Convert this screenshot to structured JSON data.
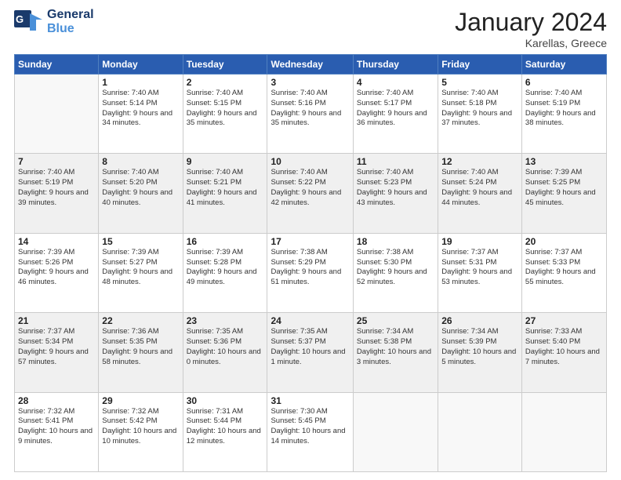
{
  "header": {
    "logo_line1": "General",
    "logo_line2": "Blue",
    "month_title": "January 2024",
    "location": "Karellas, Greece"
  },
  "weekdays": [
    "Sunday",
    "Monday",
    "Tuesday",
    "Wednesday",
    "Thursday",
    "Friday",
    "Saturday"
  ],
  "weeks": [
    [
      {
        "day": "",
        "empty": true
      },
      {
        "day": "1",
        "sunrise": "Sunrise: 7:40 AM",
        "sunset": "Sunset: 5:14 PM",
        "daylight": "Daylight: 9 hours and 34 minutes."
      },
      {
        "day": "2",
        "sunrise": "Sunrise: 7:40 AM",
        "sunset": "Sunset: 5:15 PM",
        "daylight": "Daylight: 9 hours and 35 minutes."
      },
      {
        "day": "3",
        "sunrise": "Sunrise: 7:40 AM",
        "sunset": "Sunset: 5:16 PM",
        "daylight": "Daylight: 9 hours and 35 minutes."
      },
      {
        "day": "4",
        "sunrise": "Sunrise: 7:40 AM",
        "sunset": "Sunset: 5:17 PM",
        "daylight": "Daylight: 9 hours and 36 minutes."
      },
      {
        "day": "5",
        "sunrise": "Sunrise: 7:40 AM",
        "sunset": "Sunset: 5:18 PM",
        "daylight": "Daylight: 9 hours and 37 minutes."
      },
      {
        "day": "6",
        "sunrise": "Sunrise: 7:40 AM",
        "sunset": "Sunset: 5:19 PM",
        "daylight": "Daylight: 9 hours and 38 minutes."
      }
    ],
    [
      {
        "day": "7",
        "sunrise": "Sunrise: 7:40 AM",
        "sunset": "Sunset: 5:19 PM",
        "daylight": "Daylight: 9 hours and 39 minutes."
      },
      {
        "day": "8",
        "sunrise": "Sunrise: 7:40 AM",
        "sunset": "Sunset: 5:20 PM",
        "daylight": "Daylight: 9 hours and 40 minutes."
      },
      {
        "day": "9",
        "sunrise": "Sunrise: 7:40 AM",
        "sunset": "Sunset: 5:21 PM",
        "daylight": "Daylight: 9 hours and 41 minutes."
      },
      {
        "day": "10",
        "sunrise": "Sunrise: 7:40 AM",
        "sunset": "Sunset: 5:22 PM",
        "daylight": "Daylight: 9 hours and 42 minutes."
      },
      {
        "day": "11",
        "sunrise": "Sunrise: 7:40 AM",
        "sunset": "Sunset: 5:23 PM",
        "daylight": "Daylight: 9 hours and 43 minutes."
      },
      {
        "day": "12",
        "sunrise": "Sunrise: 7:40 AM",
        "sunset": "Sunset: 5:24 PM",
        "daylight": "Daylight: 9 hours and 44 minutes."
      },
      {
        "day": "13",
        "sunrise": "Sunrise: 7:39 AM",
        "sunset": "Sunset: 5:25 PM",
        "daylight": "Daylight: 9 hours and 45 minutes."
      }
    ],
    [
      {
        "day": "14",
        "sunrise": "Sunrise: 7:39 AM",
        "sunset": "Sunset: 5:26 PM",
        "daylight": "Daylight: 9 hours and 46 minutes."
      },
      {
        "day": "15",
        "sunrise": "Sunrise: 7:39 AM",
        "sunset": "Sunset: 5:27 PM",
        "daylight": "Daylight: 9 hours and 48 minutes."
      },
      {
        "day": "16",
        "sunrise": "Sunrise: 7:39 AM",
        "sunset": "Sunset: 5:28 PM",
        "daylight": "Daylight: 9 hours and 49 minutes."
      },
      {
        "day": "17",
        "sunrise": "Sunrise: 7:38 AM",
        "sunset": "Sunset: 5:29 PM",
        "daylight": "Daylight: 9 hours and 51 minutes."
      },
      {
        "day": "18",
        "sunrise": "Sunrise: 7:38 AM",
        "sunset": "Sunset: 5:30 PM",
        "daylight": "Daylight: 9 hours and 52 minutes."
      },
      {
        "day": "19",
        "sunrise": "Sunrise: 7:37 AM",
        "sunset": "Sunset: 5:31 PM",
        "daylight": "Daylight: 9 hours and 53 minutes."
      },
      {
        "day": "20",
        "sunrise": "Sunrise: 7:37 AM",
        "sunset": "Sunset: 5:33 PM",
        "daylight": "Daylight: 9 hours and 55 minutes."
      }
    ],
    [
      {
        "day": "21",
        "sunrise": "Sunrise: 7:37 AM",
        "sunset": "Sunset: 5:34 PM",
        "daylight": "Daylight: 9 hours and 57 minutes."
      },
      {
        "day": "22",
        "sunrise": "Sunrise: 7:36 AM",
        "sunset": "Sunset: 5:35 PM",
        "daylight": "Daylight: 9 hours and 58 minutes."
      },
      {
        "day": "23",
        "sunrise": "Sunrise: 7:35 AM",
        "sunset": "Sunset: 5:36 PM",
        "daylight": "Daylight: 10 hours and 0 minutes."
      },
      {
        "day": "24",
        "sunrise": "Sunrise: 7:35 AM",
        "sunset": "Sunset: 5:37 PM",
        "daylight": "Daylight: 10 hours and 1 minute."
      },
      {
        "day": "25",
        "sunrise": "Sunrise: 7:34 AM",
        "sunset": "Sunset: 5:38 PM",
        "daylight": "Daylight: 10 hours and 3 minutes."
      },
      {
        "day": "26",
        "sunrise": "Sunrise: 7:34 AM",
        "sunset": "Sunset: 5:39 PM",
        "daylight": "Daylight: 10 hours and 5 minutes."
      },
      {
        "day": "27",
        "sunrise": "Sunrise: 7:33 AM",
        "sunset": "Sunset: 5:40 PM",
        "daylight": "Daylight: 10 hours and 7 minutes."
      }
    ],
    [
      {
        "day": "28",
        "sunrise": "Sunrise: 7:32 AM",
        "sunset": "Sunset: 5:41 PM",
        "daylight": "Daylight: 10 hours and 9 minutes."
      },
      {
        "day": "29",
        "sunrise": "Sunrise: 7:32 AM",
        "sunset": "Sunset: 5:42 PM",
        "daylight": "Daylight: 10 hours and 10 minutes."
      },
      {
        "day": "30",
        "sunrise": "Sunrise: 7:31 AM",
        "sunset": "Sunset: 5:44 PM",
        "daylight": "Daylight: 10 hours and 12 minutes."
      },
      {
        "day": "31",
        "sunrise": "Sunrise: 7:30 AM",
        "sunset": "Sunset: 5:45 PM",
        "daylight": "Daylight: 10 hours and 14 minutes."
      },
      {
        "day": "",
        "empty": true
      },
      {
        "day": "",
        "empty": true
      },
      {
        "day": "",
        "empty": true
      }
    ]
  ]
}
